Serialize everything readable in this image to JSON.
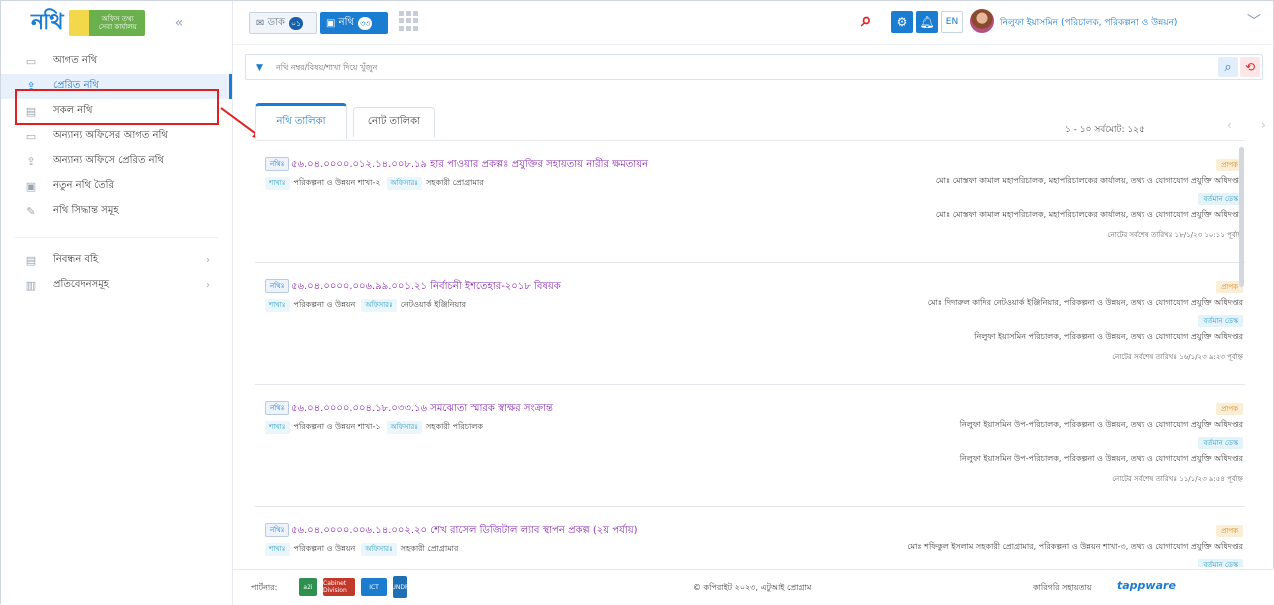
{
  "logo": {
    "word": "নথি",
    "badge_text": "অফিস তথ্য সেবা কার্যালয়"
  },
  "sidebar": {
    "items": [
      {
        "label": "আগত নথি",
        "icon": "inbox-icon"
      },
      {
        "label": "প্রেরিত নথি",
        "icon": "outbox-icon"
      },
      {
        "label": "সকল নথি",
        "icon": "folder-icon"
      },
      {
        "label": "অন্যান্য অফিসের আগত নথি",
        "icon": "inbox-icon"
      },
      {
        "label": "অন্যান্য অফিসে প্রেরিত নথি",
        "icon": "outbox-icon"
      },
      {
        "label": "নতুন নথি তৈরি",
        "icon": "new-file-icon"
      },
      {
        "label": "নথি সিদ্ধান্ত সমূহ",
        "icon": "decision-icon"
      }
    ],
    "items2": [
      {
        "label": "নিবন্ধন বহি",
        "icon": "register-icon"
      },
      {
        "label": "প্রতিবেদনসমূহ",
        "icon": "report-icon"
      }
    ]
  },
  "topbar": {
    "dak_label": "ডাক",
    "dak_count": "০১",
    "nothi_label": "নথি",
    "nothi_count": "৩৩",
    "lang": "EN",
    "user_name": "নিলুফা ইয়াসমিন (পরিচালক, পরিকল্পনা ও উন্নয়ন)"
  },
  "search": {
    "placeholder": "নথি নম্বর/বিষয়/শাখা দিয়ে খুঁজুন"
  },
  "tabs": [
    "নথি তালিকা",
    "নোট তালিকা"
  ],
  "pager": {
    "text": "১ - ১০ সর্বমোট: ১২৫"
  },
  "labels": {
    "nothi": "নথিঃ",
    "shakha": "শাখাঃ",
    "officer": "অফিসারঃ",
    "prapok": "প্রাপক",
    "current": "বর্তমান ডেস্ক"
  },
  "cards": [
    {
      "title": "৫৬.০৪.০০০০.০১২.১৪.০০৮.১৯ হার পাওয়ার প্রকল্পঃ প্রযুক্তির সহায়তায় নারীর ক্ষমতায়ন",
      "shakha": "পরিকল্পনা ও উন্নয়ন শাখা-২",
      "officer": "সহকারী প্রোগ্রামার",
      "from": "মোঃ মোস্তফা কামাল মহাপরিচালক, মহাপরিচালকের কার্যালয়, তথ্য ও যোগাযোগ প্রযুক্তি অধিদপ্তর",
      "current": "মোঃ মোস্তফা কামাল মহাপরিচালক, মহাপরিচালকের কার্যালয়, তথ্য ও যোগাযোগ প্রযুক্তি অধিদপ্তর",
      "note": "নোটের সর্বশেষ তারিখঃ ১৮/১/২৩ ১০:১১ পূর্বাহ্ন"
    },
    {
      "title": "৫৬.০৪.০০০০.০০৬.৯৯.০০১.২১ নির্বাচনী ইশতেহার-২০১৮ বিষয়ক",
      "shakha": "পরিকল্পনা ও উন্নয়ন",
      "officer": "নেটওয়ার্ক ইঞ্জিনিয়ার",
      "from": "মোঃ দিদারুল কাদির নেটওয়ার্ক ইঞ্জিনিয়ার, পরিকল্পনা ও উন্নয়ন, তথ্য ও যোগাযোগ প্রযুক্তি অধিদপ্তর",
      "current": "নিলুফা ইয়াসমিন পরিচালক, পরিকল্পনা ও উন্নয়ন, তথ্য ও যোগাযোগ প্রযুক্তি অধিদপ্তর",
      "note": "নোটের সর্বশেষ তারিখঃ ১৬/১/২৩ ৯:২৩ পূর্বাহ্ন"
    },
    {
      "title": "৫৬.০৪.০০০০.০০৪.১৮.০৩৩.১৬ সমঝোতা স্মারক স্বাক্ষর সংক্রান্ত",
      "shakha": "পরিকল্পনা ও উন্নয়ন শাখা-১",
      "officer": "সহকারী পরিচালক",
      "from": "নিলুফা ইয়াসমিন উপ-পরিচালক, পরিকল্পনা ও উন্নয়ন, তথ্য ও যোগাযোগ প্রযুক্তি অধিদপ্তর",
      "current": "নিলুফা ইয়াসমিন উপ-পরিচালক, পরিকল্পনা ও উন্নয়ন, তথ্য ও যোগাযোগ প্রযুক্তি অধিদপ্তর",
      "note": "নোটের সর্বশেষ তারিখঃ ১১/১/২৩ ৯:৫৪ পূর্বাহ্ন"
    },
    {
      "title": "৫৬.০৪.০০০০.০০৬.১৪.০০২.২০ শেখ রাসেল ডিজিটাল ল্যাব স্থাপন প্রকল্প (২য় পর্যায়)",
      "shakha": "পরিকল্পনা ও উন্নয়ন",
      "officer": "সহকারী প্রোগ্রামার",
      "from": "মোঃ শফিকুল ইসলাম সহকারী প্রোগ্রামার, পরিকল্পনা ও উন্নয়ন শাখা-৩, তথ্য ও যোগাযোগ প্রযুক্তি অধিদপ্তর",
      "current": "",
      "note": ""
    }
  ],
  "footer": {
    "partner": "পার্টনার:",
    "logos": [
      "a2i",
      "Cabinet Division",
      "ICT",
      "UNDP"
    ],
    "copyright": "© কপিরাইট ২০২৩, এটুআই প্রোগ্রাম",
    "tech": "কারিগরি সহায়তায়",
    "tappware": "tappware"
  }
}
